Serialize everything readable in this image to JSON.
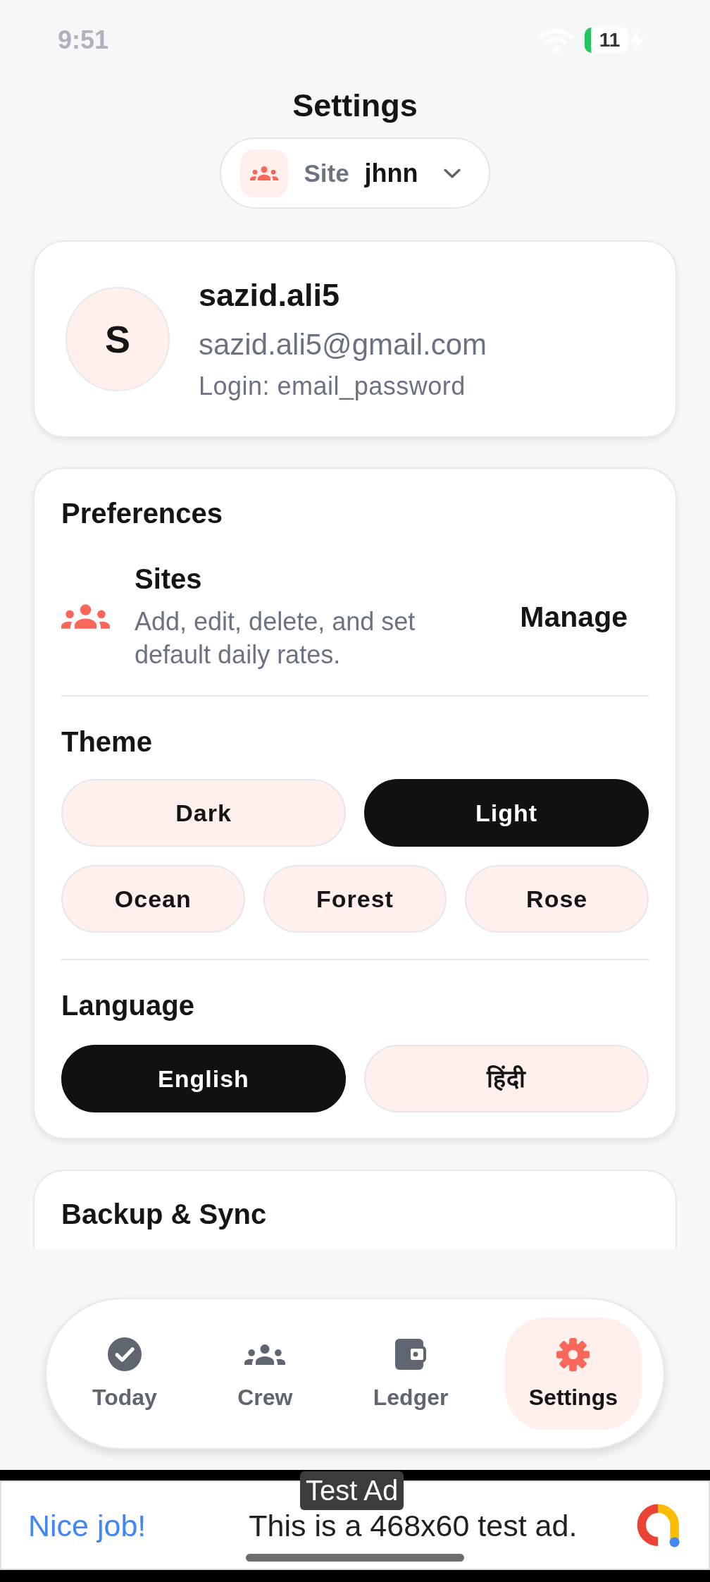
{
  "status_bar": {
    "time": "9:51",
    "battery": "11"
  },
  "header": {
    "title": "Settings",
    "site_selector": {
      "label": "Site",
      "value": "jhnn"
    }
  },
  "profile": {
    "initial": "S",
    "name": "sazid.ali5",
    "email": "sazid.ali5@gmail.com",
    "login": "Login: email_password"
  },
  "preferences": {
    "title": "Preferences",
    "sites": {
      "title": "Sites",
      "description": "Add, edit, delete, and set default daily rates.",
      "action": "Manage"
    },
    "theme": {
      "title": "Theme",
      "options": [
        {
          "label": "Dark",
          "selected": false
        },
        {
          "label": "Light",
          "selected": true
        },
        {
          "label": "Ocean",
          "selected": false
        },
        {
          "label": "Forest",
          "selected": false
        },
        {
          "label": "Rose",
          "selected": false
        }
      ]
    },
    "language": {
      "title": "Language",
      "options": [
        {
          "label": "English",
          "selected": true
        },
        {
          "label": "हिंदी",
          "selected": false
        }
      ]
    }
  },
  "backup": {
    "title": "Backup & Sync"
  },
  "bottom_nav": [
    {
      "label": "Today",
      "selected": false
    },
    {
      "label": "Crew",
      "selected": false
    },
    {
      "label": "Ledger",
      "selected": false
    },
    {
      "label": "Settings",
      "selected": true
    }
  ],
  "ad": {
    "badge": "Test Ad",
    "headline": "Nice job!",
    "text": "This is a 468x60 test ad."
  }
}
